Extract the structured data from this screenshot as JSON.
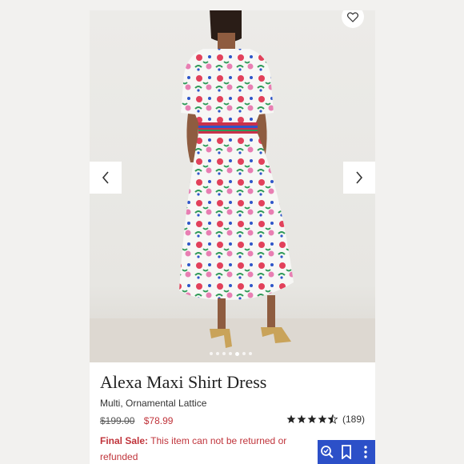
{
  "product": {
    "name": "Alexa Maxi Shirt Dress",
    "variant": "Multi, Ornamental Lattice",
    "original_price": "$199.00",
    "sale_price": "$78.99",
    "rating_stars": 4.5,
    "review_count": "(189)",
    "final_sale_label": "Final Sale:",
    "final_sale_text": " This item can not be returned or refunded"
  },
  "gallery": {
    "total_images": 7,
    "active_index": 4,
    "prev_icon": "chevron-left-icon",
    "next_icon": "chevron-right-icon",
    "favorite_icon": "heart-icon"
  },
  "toolbar": {
    "icons": [
      "magnify-search-icon",
      "bookmark-icon",
      "more-icon"
    ]
  },
  "colors": {
    "sale": "#c0343b",
    "toolbar": "#2c50c8"
  }
}
